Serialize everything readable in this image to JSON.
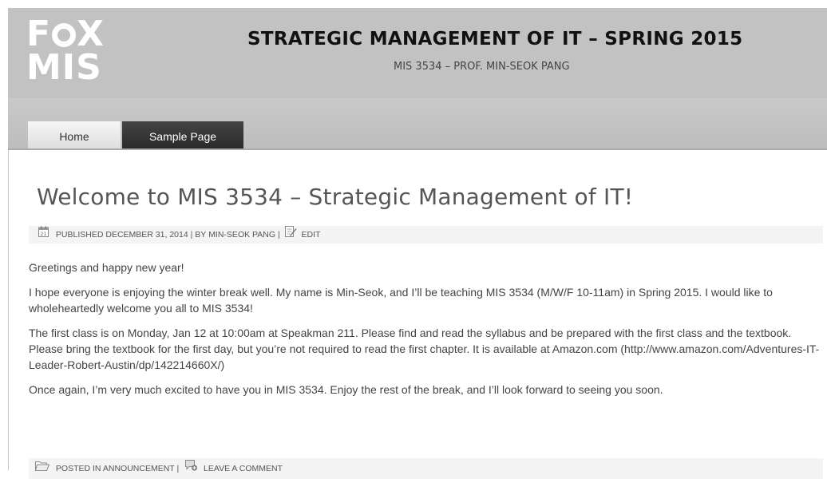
{
  "header": {
    "logo_line1_a": "F",
    "logo_line1_b": "X",
    "logo_line2": "MIS",
    "site_title": "STRATEGIC MANAGEMENT OF IT – SPRING 2015",
    "site_description": "MIS 3534 – PROF. MIN-SEOK PANG"
  },
  "nav": {
    "home": "Home",
    "sample_page": "Sample Page"
  },
  "post": {
    "title": "Welcome to MIS 3534 – Strategic Management of IT!",
    "meta": {
      "published_prefix": "PUBLISHED",
      "date": "DECEMBER 31, 2014",
      "by": "| BY",
      "author": "MIN-SEOK PANG",
      "sep": "|",
      "edit": "EDIT"
    },
    "paragraphs": [
      "Greetings and happy new year!",
      "I hope everyone is enjoying the winter break well. My name is Min-Seok, and I’ll be teaching MIS 3534 (M/W/F 10-11am) in Spring 2015. I would like to wholeheartedly welcome you all to MIS 3534!",
      "The first class is on Monday, Jan 12 at 10:00am at Speakman 211. Please find and read the syllabus and be prepared with the first class and the textbook. Please bring the textbook for the first day, but you’re not required to read the first chapter. It is available at Amazon.com (http://www.amazon.com/Adventures-IT-Leader-Robert-Austin/dp/142214660X/)",
      "Once again, I’m very much excited to have you in MIS 3534. Enjoy the rest of the break, and I’ll look forward to seeing you soon."
    ],
    "footer": {
      "posted_in": "POSTED IN",
      "category": "ANNOUNCEMENT",
      "sep": "|",
      "comment": "LEAVE A COMMENT"
    }
  },
  "icons": {
    "calendar": "calendar-icon",
    "edit": "edit-icon",
    "folder": "folder-icon",
    "comment": "comment-icon"
  },
  "colors": {
    "header_bg": "#c2c2c2",
    "nav_active": "#333333",
    "title_text": "#555555"
  }
}
